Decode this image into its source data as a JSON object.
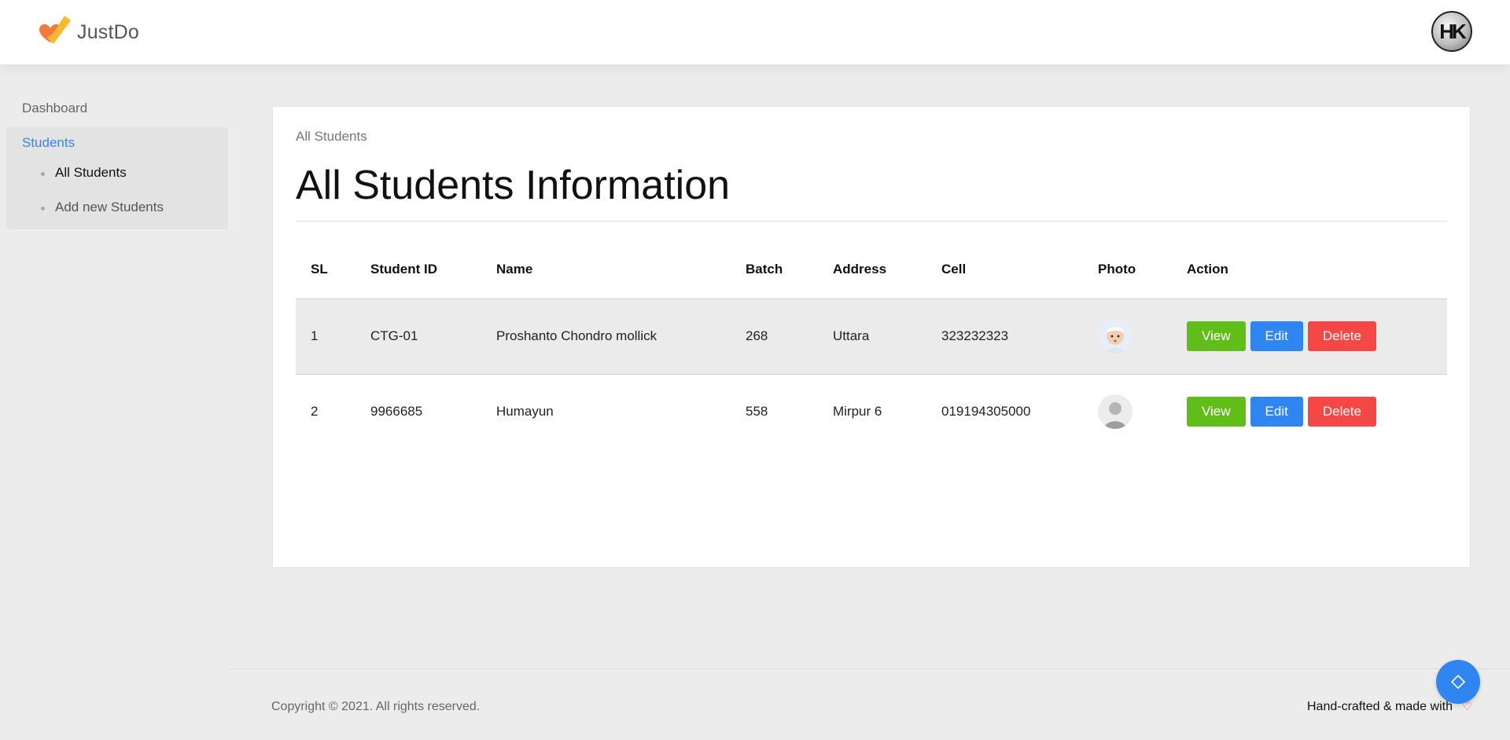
{
  "app": {
    "name": "JustDo",
    "user_initials": "HK"
  },
  "sidebar": {
    "items": [
      {
        "label": "Dashboard"
      },
      {
        "label": "Students",
        "sub_items": [
          "All Students",
          "Add new Students"
        ]
      }
    ]
  },
  "main": {
    "breadcrumb": "All Students",
    "title": "All Students Information",
    "table": {
      "columns": [
        "SL",
        "Student ID",
        "Name",
        "Batch",
        "Address",
        "Cell",
        "Photo",
        "Action"
      ],
      "rows": [
        {
          "sl": "1",
          "student_id": "CTG-01",
          "name": "Proshanto Chondro mollick",
          "batch": "268",
          "address": "Uttara",
          "cell": "323232323"
        },
        {
          "sl": "2",
          "student_id": "9966685",
          "name": "Humayun",
          "batch": "558",
          "address": "Mirpur 6",
          "cell": "019194305000"
        }
      ],
      "actions": {
        "view": "View",
        "edit": "Edit",
        "delete": "Delete"
      }
    }
  },
  "footer": {
    "copyright": "Copyright © 2021. All rights reserved.",
    "made_with": "Hand-crafted & made with"
  },
  "colors": {
    "primary": "#2f86f0",
    "success": "#61bd1a",
    "danger": "#f64747"
  }
}
